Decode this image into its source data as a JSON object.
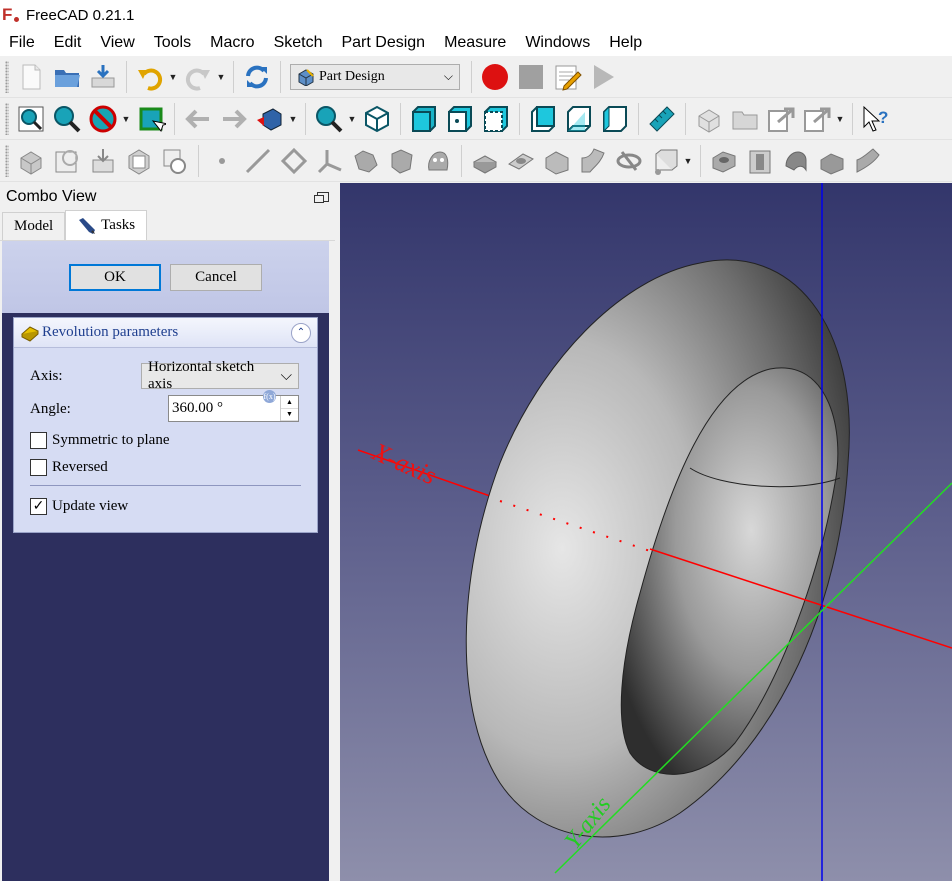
{
  "window": {
    "title": "FreeCAD 0.21.1"
  },
  "menu": [
    "File",
    "Edit",
    "View",
    "Tools",
    "Macro",
    "Sketch",
    "Part Design",
    "Measure",
    "Windows",
    "Help"
  ],
  "toolbar": {
    "workbench": "Part Design",
    "icons_row1": [
      "new-file-icon",
      "open-file-icon",
      "save-file-icon",
      "undo-icon",
      "redo-icon",
      "refresh-icon",
      "workbench-selector",
      "record-macro-icon",
      "stop-macro-icon",
      "edit-macro-icon",
      "run-macro-icon"
    ],
    "icons_row2": [
      "fit-all-icon",
      "fit-selection-icon",
      "draw-style-icon",
      "bounding-box-icon",
      "back-icon",
      "forward-icon",
      "std-views-icon",
      "isometric-view-icon",
      "front-view-icon",
      "top-view-icon",
      "right-view-icon",
      "rear-view-icon",
      "bottom-view-icon",
      "left-view-icon",
      "measure-distance-icon",
      "part-icon",
      "group-icon",
      "link-icon",
      "link-actions-icon",
      "whats-this-icon"
    ],
    "icons_row3": [
      "create-body-icon",
      "create-sketch-icon",
      "validate-sketch-icon",
      "shape-binder-icon",
      "clone-icon",
      "datum-point-icon",
      "datum-line-icon",
      "datum-plane-icon",
      "local-cs-icon",
      "sub-shape-binder-icon",
      "pad-icon",
      "pocket-icon",
      "revolution-icon",
      "groove-icon",
      "additive-loft-icon",
      "additive-pipe-icon",
      "additive-helix-icon",
      "additive-box-icon",
      "subtractive-box-icon",
      "hole-icon",
      "subtractive-loft-icon",
      "subtractive-pipe-icon",
      "subtractive-helix-icon"
    ]
  },
  "combo": {
    "title": "Combo View",
    "tabs": {
      "model": "Model",
      "tasks": "Tasks"
    },
    "ok": "OK",
    "cancel": "Cancel",
    "panel_title": "Revolution parameters",
    "axis_label": "Axis:",
    "axis_value": "Horizontal sketch axis",
    "angle_label": "Angle:",
    "angle_value": "360.00 °",
    "symmetric": {
      "label": "Symmetric to plane",
      "checked": false
    },
    "reversed": {
      "label": "Reversed",
      "checked": false
    },
    "update_view": {
      "label": "Update view",
      "checked": true
    }
  },
  "viewport": {
    "x_axis_label": "X-axis",
    "y_axis_label": "Y-axis",
    "colors": {
      "x_axis": "#ff0000",
      "y_axis": "#22dd22",
      "z_axis": "#0000ee"
    }
  }
}
